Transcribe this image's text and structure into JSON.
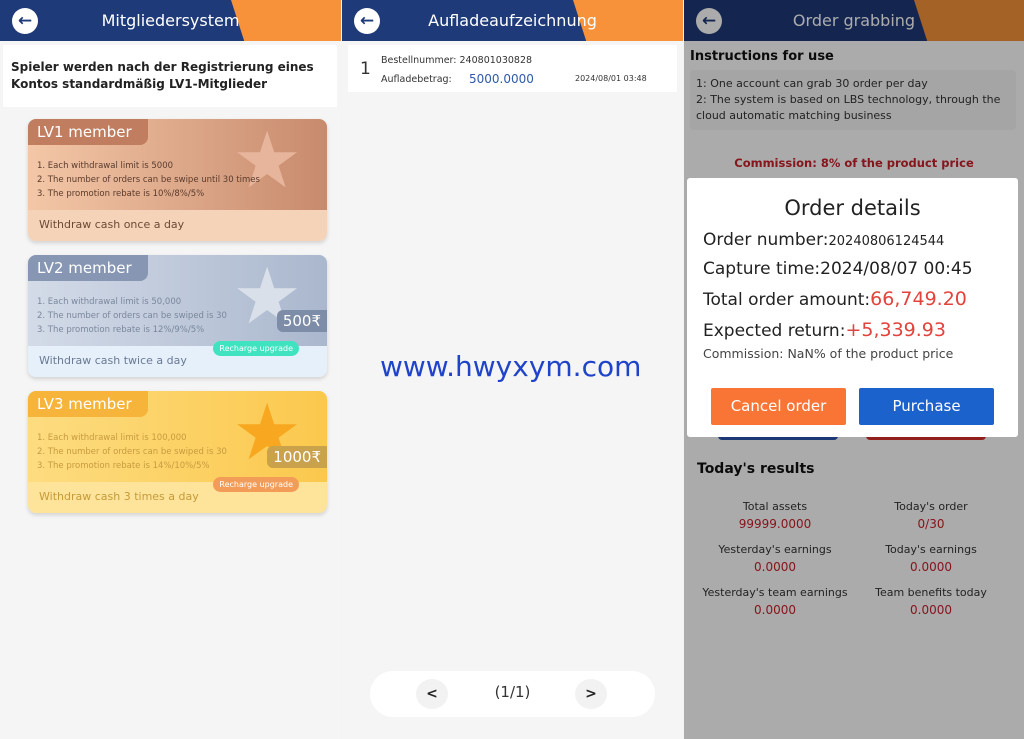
{
  "membership": {
    "title": "Mitgliedersystem",
    "intro": "Spieler werden nach der Registrierung eines Kontos standardmäßig LV1-Mitglieder",
    "cards": [
      {
        "name": "LV1 member",
        "rules": [
          "1. Each withdrawal limit is 5000",
          "2. The number of orders can be swipe until 30 times",
          "3. The promotion rebate is 10%/8%/5%"
        ],
        "withdraw": "Withdraw cash once a day"
      },
      {
        "name": "LV2 member",
        "rules": [
          "1. Each withdrawal limit is 50,000",
          "2. The number of orders can be swiped is 30",
          "3. The promotion rebate is 12%/9%/5%"
        ],
        "withdraw": "Withdraw cash twice a day",
        "price": "500₹",
        "button": "Recharge upgrade"
      },
      {
        "name": "LV3 member",
        "rules": [
          "1. Each withdrawal limit is 100,000",
          "2. The number of orders can be swiped is 30",
          "3. The promotion rebate is 14%/10%/5%"
        ],
        "withdraw": "Withdraw cash 3 times a day",
        "price": "1000₹",
        "button": "Recharge upgrade"
      }
    ]
  },
  "recharge": {
    "title": "Aufladeaufzeichnung",
    "records": [
      {
        "index": "1",
        "order_label": "Bestellnummer: 240801030828",
        "amount_label": "Aufladebetrag:",
        "amount": "5000.0000",
        "datetime": "2024/08/01 03:48"
      }
    ],
    "pager": {
      "prev": "<",
      "page": "(1/1)",
      "next": ">"
    }
  },
  "watermark": "www.hwyxym.com",
  "grab": {
    "title": "Order grabbing",
    "instructions_title": "Instructions for use",
    "instructions": [
      "1: One account can grab 30 order per day",
      "2: The system is based on LBS technology, through the cloud automatic matching business"
    ],
    "commission": "Commission: 8% of the product price",
    "results_title": "Today's results",
    "stats": [
      {
        "label": "Total assets",
        "value": "99999.0000"
      },
      {
        "label": "Today's order",
        "value": "0/30"
      },
      {
        "label": "Yesterday's earnings",
        "value": "0.0000"
      },
      {
        "label": "Today's earnings",
        "value": "0.0000"
      },
      {
        "label": "Yesterday's team earnings",
        "value": "0.0000"
      },
      {
        "label": "Team benefits today",
        "value": "0.0000"
      }
    ],
    "modal": {
      "title": "Order details",
      "order_label": "Order number:",
      "order_number": "20240806124544",
      "capture_label": "Capture time:",
      "capture_time": "2024/08/07 00:45",
      "total_label": "Total order amount:",
      "total": "66,749.20",
      "return_label": "Expected return:",
      "return": "+5,339.93",
      "commission": "Commission: NaN% of the product price",
      "cancel": "Cancel order",
      "purchase": "Purchase"
    }
  },
  "colors": {
    "header": "#1e3a78",
    "accent": "#f7923a",
    "red": "#e2433b",
    "purchase": "#1b62cc",
    "cancel": "#f97535"
  }
}
